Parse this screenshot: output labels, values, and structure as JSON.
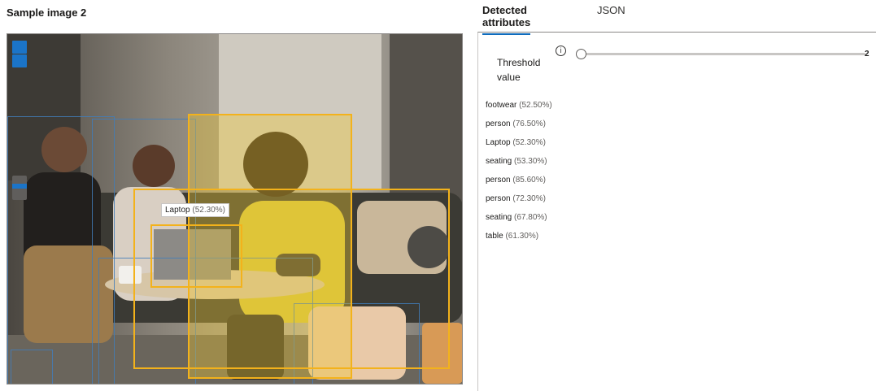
{
  "header": {
    "title": "Sample image 2"
  },
  "tabs": [
    {
      "label": "Detected attributes",
      "active": true
    },
    {
      "label": "JSON",
      "active": false
    }
  ],
  "threshold": {
    "label": "Threshold value",
    "info_icon": "info-icon",
    "value": "2",
    "slider_fraction": 0
  },
  "tooltip": {
    "name": "Laptop",
    "confidence": "(52.30%)"
  },
  "attributes": [
    {
      "name": "footwear",
      "confidence": "(52.50%)"
    },
    {
      "name": "person",
      "confidence": "(76.50%)"
    },
    {
      "name": "Laptop",
      "confidence": "(52.30%)"
    },
    {
      "name": "seating",
      "confidence": "(53.30%)"
    },
    {
      "name": "person",
      "confidence": "(85.60%)"
    },
    {
      "name": "person",
      "confidence": "(72.30%)"
    },
    {
      "name": "seating",
      "confidence": "(67.80%)"
    },
    {
      "name": "table",
      "confidence": "(61.30%)"
    }
  ],
  "colors": {
    "accent": "#0f6cbd",
    "highlight_box": "#f3b21b",
    "detection_box": "#427db9"
  }
}
